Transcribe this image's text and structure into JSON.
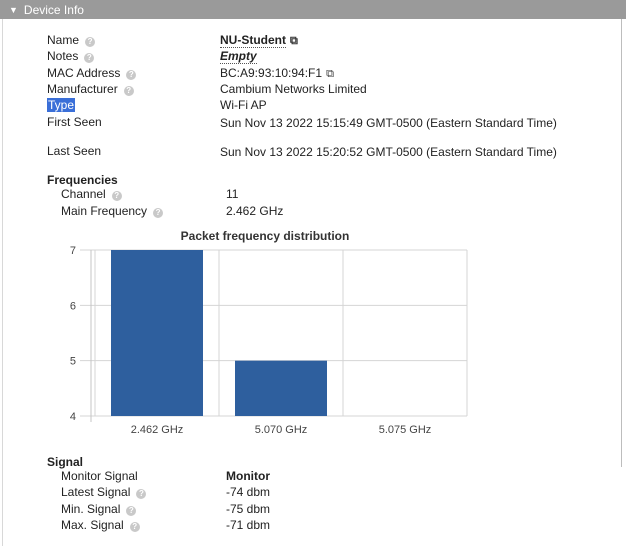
{
  "header": {
    "title": "Device Info"
  },
  "details": [
    {
      "key": "name",
      "label": "Name",
      "value": "NU-Student",
      "help": true
    },
    {
      "key": "notes",
      "label": "Notes",
      "value": "Empty",
      "help": true
    },
    {
      "key": "mac",
      "label": "MAC Address",
      "value": "BC:A9:93:10:94:F1",
      "help": true
    },
    {
      "key": "manufacturer",
      "label": "Manufacturer",
      "value": "Cambium Networks Limited",
      "help": true
    },
    {
      "key": "type",
      "label": "Type",
      "value": "Wi-Fi AP",
      "help": false
    },
    {
      "key": "first_seen",
      "label": "First Seen",
      "value": "Sun Nov 13 2022 15:15:49 GMT-0500 (Eastern Standard Time)",
      "help": false
    },
    {
      "key": "last_seen",
      "label": "Last Seen",
      "value": "Sun Nov 13 2022 15:20:52 GMT-0500 (Eastern Standard Time)",
      "help": false
    }
  ],
  "frequencies": {
    "title": "Frequencies",
    "channel_label": "Channel",
    "channel_value": "11",
    "main_freq_label": "Main Frequency",
    "main_freq_value": "2.462 GHz"
  },
  "chart_data": {
    "type": "bar",
    "title": "Packet frequency distribution",
    "categories": [
      "2.462 GHz",
      "5.070 GHz",
      "5.075 GHz"
    ],
    "values": [
      7,
      5,
      4
    ],
    "ylim": [
      4,
      7
    ],
    "yticks": [
      "4",
      "5",
      "6",
      "7"
    ],
    "grid": true,
    "bar_color": "#2e5f9e"
  },
  "signal": {
    "title": "Signal",
    "monitor_label": "Monitor Signal",
    "monitor_value": "Monitor",
    "latest_label": "Latest Signal",
    "latest_value": "-74 dbm",
    "min_label": "Min. Signal",
    "min_value": "-75 dbm",
    "max_label": "Max. Signal",
    "max_value": "-71 dbm"
  }
}
